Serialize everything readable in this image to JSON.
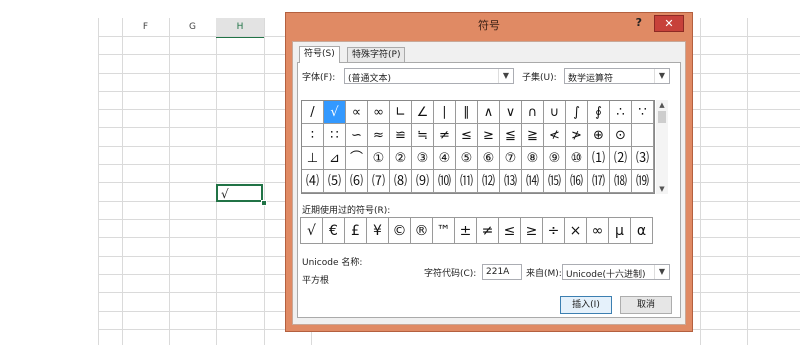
{
  "sheet": {
    "columns": [
      "F",
      "G",
      "H"
    ],
    "active_cell_value": "√"
  },
  "dialog": {
    "title": "符号",
    "help": "?",
    "close": "✕",
    "tabs": [
      "符号(S)",
      "特殊字符(P)"
    ],
    "font_label": "字体(F):",
    "font_value": "(普通文本)",
    "subset_label": "子集(U):",
    "subset_value": "数学运算符",
    "symbols": [
      [
        "/",
        "√",
        "∝",
        "∞",
        "∟",
        "∠",
        "∣",
        "∥",
        "∧",
        "∨",
        "∩",
        "∪",
        "∫",
        "∮",
        "∴",
        "∵"
      ],
      [
        "∶",
        "∷",
        "∽",
        "≈",
        "≌",
        "≒",
        "≠",
        "≤",
        "≥",
        "≦",
        "≧",
        "≮",
        "≯",
        "⊕",
        "⊙",
        ""
      ],
      [
        "⊥",
        "⊿",
        "⌒",
        "①",
        "②",
        "③",
        "④",
        "⑤",
        "⑥",
        "⑦",
        "⑧",
        "⑨",
        "⑩",
        "⑴",
        "⑵",
        "⑶"
      ],
      [
        "⑷",
        "⑸",
        "⑹",
        "⑺",
        "⑻",
        "⑼",
        "⑽",
        "⑾",
        "⑿",
        "⒀",
        "⒁",
        "⒂",
        "⒃",
        "⒄",
        "⒅",
        "⒆"
      ]
    ],
    "selected_symbol": "√",
    "recent_label": "近期使用过的符号(R):",
    "recent": [
      "√",
      "€",
      "£",
      "¥",
      "©",
      "®",
      "™",
      "±",
      "≠",
      "≤",
      "≥",
      "÷",
      "×",
      "∞",
      "µ",
      "α"
    ],
    "unicode_name_label": "Unicode 名称:",
    "unicode_name": "平方根",
    "char_code_label": "字符代码(C):",
    "char_code": "221A",
    "from_label": "来自(M):",
    "from_value": "Unicode(十六进制)",
    "insert": "插入(I)",
    "cancel": "取消"
  }
}
